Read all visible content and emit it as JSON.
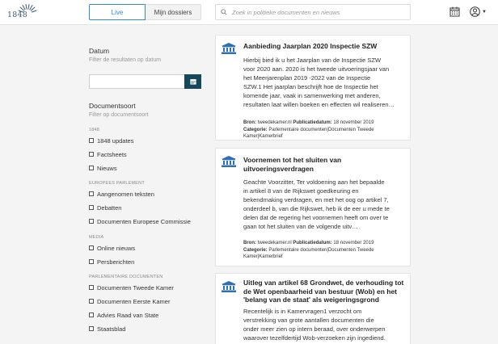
{
  "header": {
    "logo_text": "1848",
    "tabs": [
      {
        "label": "Live",
        "active": true
      },
      {
        "label": "Mijn dossiers",
        "active": false
      }
    ],
    "search_placeholder": "Zoek in politieke documenten en nieuws",
    "accent_color": "#2f8bd6"
  },
  "sidebar": {
    "date_title": "Datum",
    "date_sub": "Filter de resultaten op datum",
    "doc_title": "Documentsoort",
    "doc_sub": "Filter op documentsoort",
    "groups": [
      {
        "label": "1848",
        "items": [
          "1848 updates",
          "Factsheets",
          "Nieuws"
        ]
      },
      {
        "label": "Europees parlement",
        "items": [
          "Aangenomen teksten",
          "Debatten",
          "Documenten Europese Commissie"
        ]
      },
      {
        "label": "Media",
        "items": [
          "Online nieuws",
          "Persberichten"
        ]
      },
      {
        "label": "Parlementaire documenten",
        "items": [
          "Documenten Tweede Kamer",
          "Documenten Eerste Kamer",
          "Advies Raad van State",
          "Staatsblad"
        ]
      }
    ],
    "button_color": "#17485a"
  },
  "cards": [
    {
      "title_lines": [
        "Aanbieding Jaarplan 2020 Inspectie SZW"
      ],
      "body_lines": [
        "Hierbij bied ik u het Jaarplan van de Inspectie SZW",
        "voor 2020 aan. 2020 is het tweede uitvoeringsjaar van",
        "het Meerjarenplan 2019 -2022 van de Inspectie",
        "SZW.1 Het jaarplan beschrijft hoe de Inspectie het",
        "komende jaar, vaak in samenwerking met anderen,",
        "resultaten laat willen boeken en effecten wil realiseren…"
      ],
      "bron_label": "Bron:",
      "bron": "tweedekamer.nl",
      "pub_label": "Publicatiedatum:",
      "pub": "18 november 2019",
      "cat_label": "Categorie:",
      "cat_lines": [
        "Parlementaire documenten|Documenten Tweede",
        "Kamer|Kamerbrief"
      ]
    },
    {
      "title_lines": [
        "Voornemen tot het sluiten van",
        "uitvoeringsverdragen"
      ],
      "body_lines": [
        "Geachte Voorzitter, Ter voldoening aan het bepaalde",
        "in artikel 8 van de Rijkswet goedkeuring en",
        "bekendmaking verdragen, en met het oog op artikel 7,",
        "onderdeel b, van die Rijkswet, heb ik de eer u mede te",
        "delen dat de regering het voornemen heeft om over te",
        "gaan tot het sluiten van de volgende uitv…"
      ],
      "bron_label": "Bron:",
      "bron": "tweedekamer.nl",
      "pub_label": "Publicatiedatum:",
      "pub": "18 november 2019",
      "cat_label": "Categorie:",
      "cat_lines": [
        "Parlementaire documenten|Documenten Tweede",
        "Kamer|Kamerbrief"
      ]
    },
    {
      "title_lines": [
        "Uitleg van artikel 68 Grondwet, de verhouding tot",
        "de Wet openbaarheid van bestuur (Wob) en het",
        "'belang van de staat' als weigeringsgrond"
      ],
      "body_lines": [
        "Recentelijk is in Kamervragen1 verzocht om",
        "verstrekking van grote aantallen documenten die",
        "onder meer zien op intern beraad, over onderwerpen",
        "waarover tezelfdertijd Wob-verzoeken zijn ingediend."
      ]
    }
  ]
}
